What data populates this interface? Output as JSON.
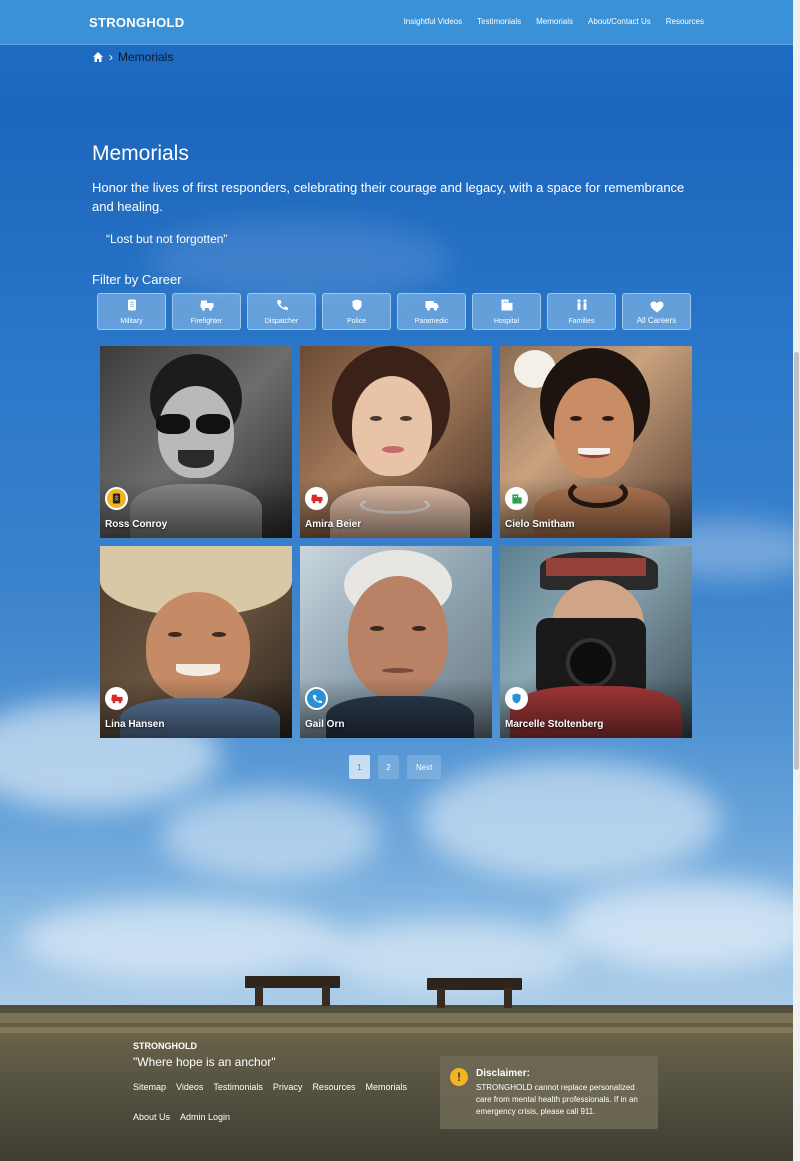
{
  "header": {
    "brand": "STRONGHOLD",
    "nav": [
      "Insightful Videos",
      "Testimonials",
      "Memorials",
      "About/Contact Us",
      "Resources"
    ]
  },
  "breadcrumb": {
    "home_icon": "home-icon",
    "separator": "›",
    "current": "Memorials"
  },
  "page": {
    "title": "Memorials",
    "intro": "Honor the lives of first responders, celebrating their courage and legacy, with a space for remembrance and healing.",
    "quote": "“Lost but not forgotten”",
    "filter_label": "Filter by Career"
  },
  "filters": [
    {
      "label": "Military",
      "icon": "military-icon"
    },
    {
      "label": "Firefighter",
      "icon": "fire-truck-icon"
    },
    {
      "label": "Dispatcher",
      "icon": "phone-icon"
    },
    {
      "label": "Police",
      "icon": "shield-icon"
    },
    {
      "label": "Paramedic",
      "icon": "ambulance-icon"
    },
    {
      "label": "Hospital",
      "icon": "hospital-icon"
    },
    {
      "label": "Families",
      "icon": "family-icon"
    },
    {
      "label": "All Careers",
      "icon": "heart-icon"
    }
  ],
  "memorials": [
    {
      "name": "Ross Conroy",
      "career_icon": "military-icon",
      "badge_color": "#f2b321"
    },
    {
      "name": "Amira Beier",
      "career_icon": "fire-truck-icon",
      "badge_color": "#ffffff"
    },
    {
      "name": "Cielo Smitham",
      "career_icon": "hospital-icon",
      "badge_color": "#ffffff"
    },
    {
      "name": "Lina Hansen",
      "career_icon": "fire-truck-icon",
      "badge_color": "#ffffff"
    },
    {
      "name": "Gail Orn",
      "career_icon": "phone-icon",
      "badge_color": "#2a8fd4"
    },
    {
      "name": "Marcelle Stoltenberg",
      "career_icon": "shield-icon",
      "badge_color": "#ffffff"
    }
  ],
  "pagination": {
    "pages": [
      "1",
      "2"
    ],
    "current": "1",
    "next": "Next"
  },
  "footer": {
    "brand": "STRONGHOLD",
    "tagline": "\"Where hope is an anchor\"",
    "links": [
      "Sitemap",
      "Videos",
      "Testimonials",
      "Privacy",
      "Resources",
      "Memorials"
    ],
    "links2": [
      "About Us",
      "Admin Login"
    ],
    "disclaimer_title": "Disclaimer:",
    "disclaimer_text": "STRONGHOLD cannot replace personalized care from mental health professionals. If in an emergency crisis, please call 911."
  },
  "colors": {
    "header_bg": "#3a91d6",
    "warning": "#f0b424"
  }
}
